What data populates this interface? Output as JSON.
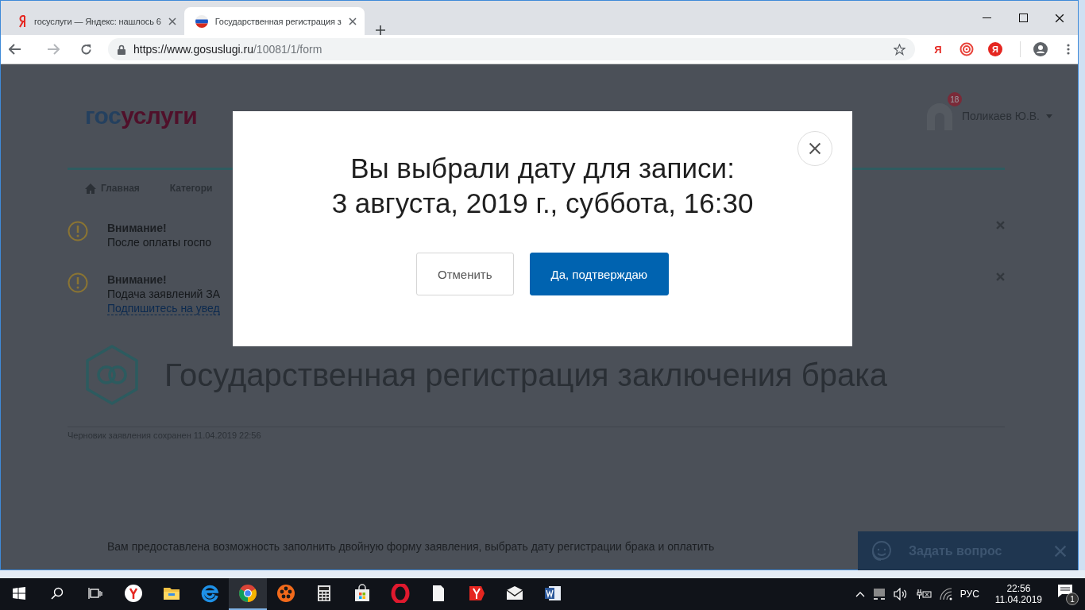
{
  "browser": {
    "tabs": [
      {
        "title": "госуслуги — Яндекс: нашлось 6",
        "kind": "yandex",
        "selected": false
      },
      {
        "title": "Государственная регистрация з",
        "kind": "flag",
        "selected": true
      }
    ],
    "url": {
      "host": "https://www.gosuslugi.ru",
      "path": "/10081/1/form"
    },
    "extensions": [
      {
        "kind": "letter",
        "label": "Я"
      },
      {
        "kind": "target"
      },
      {
        "kind": "round",
        "label": "Я"
      }
    ]
  },
  "site": {
    "logo": {
      "first": "гос",
      "second": "услуги"
    },
    "user": {
      "name": "Поликаев Ю.В.",
      "badge": "18"
    },
    "nav": [
      {
        "label": "Главная",
        "kind": "home"
      },
      {
        "label": "Категори",
        "kind": "plain"
      }
    ],
    "alerts": [
      {
        "title": "Внимание!",
        "text": "После оплаты госпо"
      },
      {
        "title": "Внимание!",
        "text": "Подача заявлений ЗА",
        "link": "Подпишитесь на увед"
      }
    ],
    "service_title": "Государственная регистрация заключения брака",
    "draft_note": "Черновик заявления сохранен 11.04.2019 22:56",
    "intro": "Вам предоставлена возможность заполнить двойную форму заявления, выбрать дату регистрации брака и оплатить",
    "chat": {
      "label": "Задать вопрос"
    }
  },
  "modal": {
    "lines": [
      "Вы выбрали дату для записи:",
      "3 августа, 2019 г., суббота, 16:30"
    ],
    "buttons": [
      {
        "label": "Отменить",
        "kind": "secondary"
      },
      {
        "label": "Да, подтверждаю",
        "kind": "primary"
      }
    ]
  },
  "taskbar": {
    "apps": [
      {
        "kind": "yandex",
        "active": false
      },
      {
        "kind": "folder",
        "active": false
      },
      {
        "kind": "edge",
        "active": false
      },
      {
        "kind": "chrome",
        "active": true
      },
      {
        "kind": "reel",
        "active": false
      },
      {
        "kind": "calculator",
        "active": false
      },
      {
        "kind": "store",
        "active": false
      },
      {
        "kind": "opera",
        "active": false
      },
      {
        "kind": "file",
        "active": false
      },
      {
        "kind": "yandex-flag",
        "active": false
      },
      {
        "kind": "mail",
        "active": false
      },
      {
        "kind": "word",
        "active": false
      }
    ],
    "language": "РУС",
    "time": "22:56",
    "date": "11.04.2019",
    "notifications": "1"
  }
}
